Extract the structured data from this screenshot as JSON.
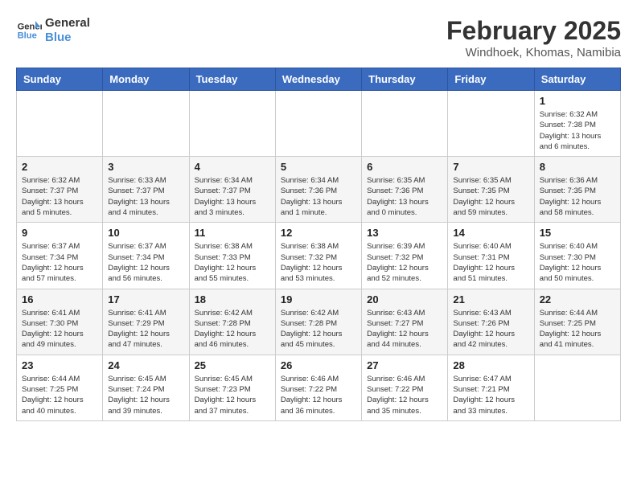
{
  "logo": {
    "text_general": "General",
    "text_blue": "Blue"
  },
  "title": "February 2025",
  "subtitle": "Windhoek, Khomas, Namibia",
  "days_of_week": [
    "Sunday",
    "Monday",
    "Tuesday",
    "Wednesday",
    "Thursday",
    "Friday",
    "Saturday"
  ],
  "weeks": [
    [
      {
        "day": "",
        "info": ""
      },
      {
        "day": "",
        "info": ""
      },
      {
        "day": "",
        "info": ""
      },
      {
        "day": "",
        "info": ""
      },
      {
        "day": "",
        "info": ""
      },
      {
        "day": "",
        "info": ""
      },
      {
        "day": "1",
        "info": "Sunrise: 6:32 AM\nSunset: 7:38 PM\nDaylight: 13 hours and 6 minutes."
      }
    ],
    [
      {
        "day": "2",
        "info": "Sunrise: 6:32 AM\nSunset: 7:37 PM\nDaylight: 13 hours and 5 minutes."
      },
      {
        "day": "3",
        "info": "Sunrise: 6:33 AM\nSunset: 7:37 PM\nDaylight: 13 hours and 4 minutes."
      },
      {
        "day": "4",
        "info": "Sunrise: 6:34 AM\nSunset: 7:37 PM\nDaylight: 13 hours and 3 minutes."
      },
      {
        "day": "5",
        "info": "Sunrise: 6:34 AM\nSunset: 7:36 PM\nDaylight: 13 hours and 1 minute."
      },
      {
        "day": "6",
        "info": "Sunrise: 6:35 AM\nSunset: 7:36 PM\nDaylight: 13 hours and 0 minutes."
      },
      {
        "day": "7",
        "info": "Sunrise: 6:35 AM\nSunset: 7:35 PM\nDaylight: 12 hours and 59 minutes."
      },
      {
        "day": "8",
        "info": "Sunrise: 6:36 AM\nSunset: 7:35 PM\nDaylight: 12 hours and 58 minutes."
      }
    ],
    [
      {
        "day": "9",
        "info": "Sunrise: 6:37 AM\nSunset: 7:34 PM\nDaylight: 12 hours and 57 minutes."
      },
      {
        "day": "10",
        "info": "Sunrise: 6:37 AM\nSunset: 7:34 PM\nDaylight: 12 hours and 56 minutes."
      },
      {
        "day": "11",
        "info": "Sunrise: 6:38 AM\nSunset: 7:33 PM\nDaylight: 12 hours and 55 minutes."
      },
      {
        "day": "12",
        "info": "Sunrise: 6:38 AM\nSunset: 7:32 PM\nDaylight: 12 hours and 53 minutes."
      },
      {
        "day": "13",
        "info": "Sunrise: 6:39 AM\nSunset: 7:32 PM\nDaylight: 12 hours and 52 minutes."
      },
      {
        "day": "14",
        "info": "Sunrise: 6:40 AM\nSunset: 7:31 PM\nDaylight: 12 hours and 51 minutes."
      },
      {
        "day": "15",
        "info": "Sunrise: 6:40 AM\nSunset: 7:30 PM\nDaylight: 12 hours and 50 minutes."
      }
    ],
    [
      {
        "day": "16",
        "info": "Sunrise: 6:41 AM\nSunset: 7:30 PM\nDaylight: 12 hours and 49 minutes."
      },
      {
        "day": "17",
        "info": "Sunrise: 6:41 AM\nSunset: 7:29 PM\nDaylight: 12 hours and 47 minutes."
      },
      {
        "day": "18",
        "info": "Sunrise: 6:42 AM\nSunset: 7:28 PM\nDaylight: 12 hours and 46 minutes."
      },
      {
        "day": "19",
        "info": "Sunrise: 6:42 AM\nSunset: 7:28 PM\nDaylight: 12 hours and 45 minutes."
      },
      {
        "day": "20",
        "info": "Sunrise: 6:43 AM\nSunset: 7:27 PM\nDaylight: 12 hours and 44 minutes."
      },
      {
        "day": "21",
        "info": "Sunrise: 6:43 AM\nSunset: 7:26 PM\nDaylight: 12 hours and 42 minutes."
      },
      {
        "day": "22",
        "info": "Sunrise: 6:44 AM\nSunset: 7:25 PM\nDaylight: 12 hours and 41 minutes."
      }
    ],
    [
      {
        "day": "23",
        "info": "Sunrise: 6:44 AM\nSunset: 7:25 PM\nDaylight: 12 hours and 40 minutes."
      },
      {
        "day": "24",
        "info": "Sunrise: 6:45 AM\nSunset: 7:24 PM\nDaylight: 12 hours and 39 minutes."
      },
      {
        "day": "25",
        "info": "Sunrise: 6:45 AM\nSunset: 7:23 PM\nDaylight: 12 hours and 37 minutes."
      },
      {
        "day": "26",
        "info": "Sunrise: 6:46 AM\nSunset: 7:22 PM\nDaylight: 12 hours and 36 minutes."
      },
      {
        "day": "27",
        "info": "Sunrise: 6:46 AM\nSunset: 7:22 PM\nDaylight: 12 hours and 35 minutes."
      },
      {
        "day": "28",
        "info": "Sunrise: 6:47 AM\nSunset: 7:21 PM\nDaylight: 12 hours and 33 minutes."
      },
      {
        "day": "",
        "info": ""
      }
    ]
  ]
}
